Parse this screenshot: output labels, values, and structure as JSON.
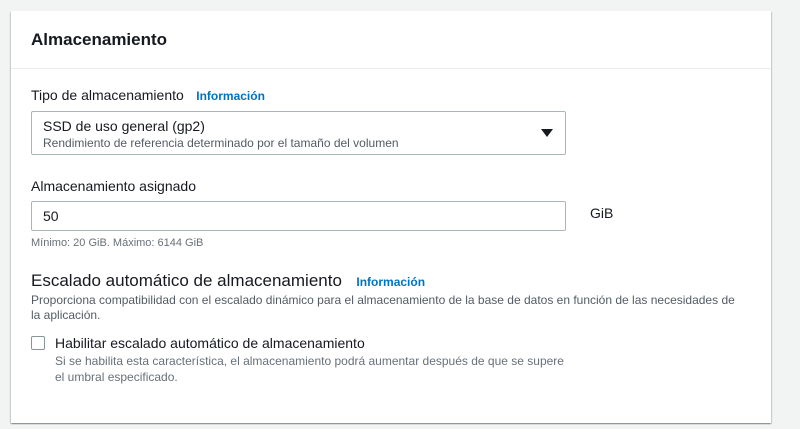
{
  "panel": {
    "title": "Almacenamiento"
  },
  "storage_type": {
    "label": "Tipo de almacenamiento",
    "info_link": "Información",
    "selected_value": "SSD de uso general (gp2)",
    "selected_description": "Rendimiento de referencia determinado por el tamaño del volumen"
  },
  "allocated_storage": {
    "label": "Almacenamiento asignado",
    "value": "50",
    "unit": "GiB",
    "constraint": "Mínimo: 20 GiB. Máximo: 6144 GiB"
  },
  "autoscaling": {
    "title": "Escalado automático de almacenamiento",
    "info_link": "Información",
    "description_line1": "Proporciona compatibilidad con el escalado dinámico para el almacenamiento de la base de datos en función de las necesidades de",
    "description_line2": "la aplicación.",
    "checkbox_label": "Habilitar escalado automático de almacenamiento",
    "checkbox_checked": false,
    "checkbox_description_line1": "Si se habilita esta característica, el almacenamiento podrá aumentar después de que se supere",
    "checkbox_description_line2": "el umbral especificado."
  },
  "icons": {
    "dropdown": "caret-down-icon",
    "checkbox": "checkbox-unchecked-icon"
  },
  "colors": {
    "link": "#0073bb",
    "border": "#aab7b8",
    "text": "#16191f"
  }
}
